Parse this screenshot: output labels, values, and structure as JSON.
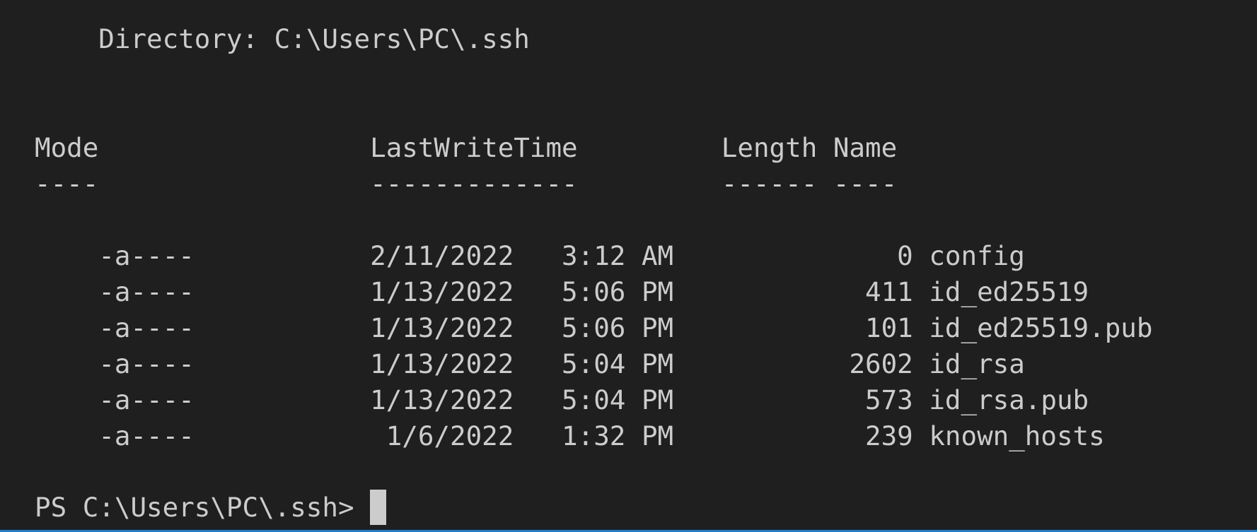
{
  "directory": {
    "label": "    Directory: ",
    "path": "C:\\Users\\PC\\.ssh"
  },
  "listing": {
    "header": "Mode                 LastWriteTime         Length Name",
    "dashes": "----                 -------------         ------ ----",
    "rows": [
      {
        "mode": "-a----",
        "date": "2/11/2022",
        "time": "3:12 AM",
        "length": "0",
        "name": "config"
      },
      {
        "mode": "-a----",
        "date": "1/13/2022",
        "time": "5:06 PM",
        "length": "411",
        "name": "id_ed25519"
      },
      {
        "mode": "-a----",
        "date": "1/13/2022",
        "time": "5:06 PM",
        "length": "101",
        "name": "id_ed25519.pub"
      },
      {
        "mode": "-a----",
        "date": "1/13/2022",
        "time": "5:04 PM",
        "length": "2602",
        "name": "id_rsa"
      },
      {
        "mode": "-a----",
        "date": "1/13/2022",
        "time": "5:04 PM",
        "length": "573",
        "name": "id_rsa.pub"
      },
      {
        "mode": "-a----",
        "date": "1/6/2022",
        "time": "1:32 PM",
        "length": "239",
        "name": "known_hosts"
      }
    ]
  },
  "prompt": {
    "text": "PS C:\\Users\\PC\\.ssh> "
  },
  "colors": {
    "background": "#1f1f1f",
    "foreground": "#cccccc",
    "accent_bar": "#1e7fd1"
  }
}
